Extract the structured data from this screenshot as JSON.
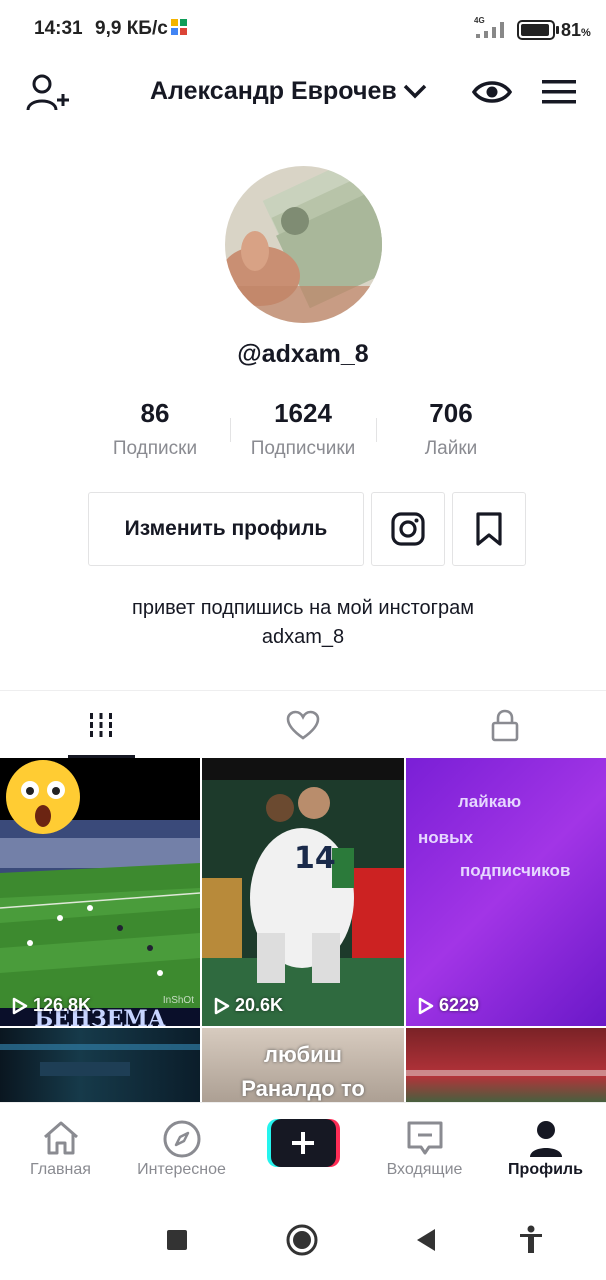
{
  "status_bar": {
    "time": "14:31",
    "speed": "9,9 КБ/с",
    "network": "4G",
    "battery": "81",
    "battery_unit": "%"
  },
  "header": {
    "username": "Александр Еврочев"
  },
  "profile": {
    "handle": "@adxam_8",
    "stats": [
      {
        "value": "86",
        "label": "Подписки"
      },
      {
        "value": "1624",
        "label": "Подписчики"
      },
      {
        "value": "706",
        "label": "Лайки"
      }
    ],
    "edit_button": "Изменить профиль",
    "bio_line1": "привет подпишись на мой инстограм",
    "bio_line2": "adxam_8"
  },
  "tabs": [
    {
      "icon": "grid-icon",
      "active": true
    },
    {
      "icon": "heart-icon",
      "active": false
    },
    {
      "icon": "lock-icon",
      "active": false
    }
  ],
  "videos": [
    {
      "views": "126.8K",
      "caption": "БЕНЗЕМА",
      "watermark": "InShOt"
    },
    {
      "views": "20.6K",
      "jersey": "14"
    },
    {
      "views": "6229",
      "text_lines": [
        "лайкаю",
        "новых",
        "подписчиков"
      ]
    },
    {
      "views": ""
    },
    {
      "views": "",
      "text_lines": [
        "любиш",
        "Раналдо то"
      ]
    },
    {
      "views": ""
    }
  ],
  "bottom_nav": [
    {
      "label": "Главная",
      "icon": "home-icon"
    },
    {
      "label": "Интересное",
      "icon": "compass-icon"
    },
    {
      "label": "",
      "icon": "plus-icon"
    },
    {
      "label": "Входящие",
      "icon": "inbox-icon"
    },
    {
      "label": "Профиль",
      "icon": "profile-icon",
      "active": true
    }
  ],
  "colors": {
    "accent_cyan": "#25f4ee",
    "accent_red": "#fe2c55",
    "text": "#161823",
    "muted": "#8a8b91",
    "purple": "#8a2be2"
  }
}
